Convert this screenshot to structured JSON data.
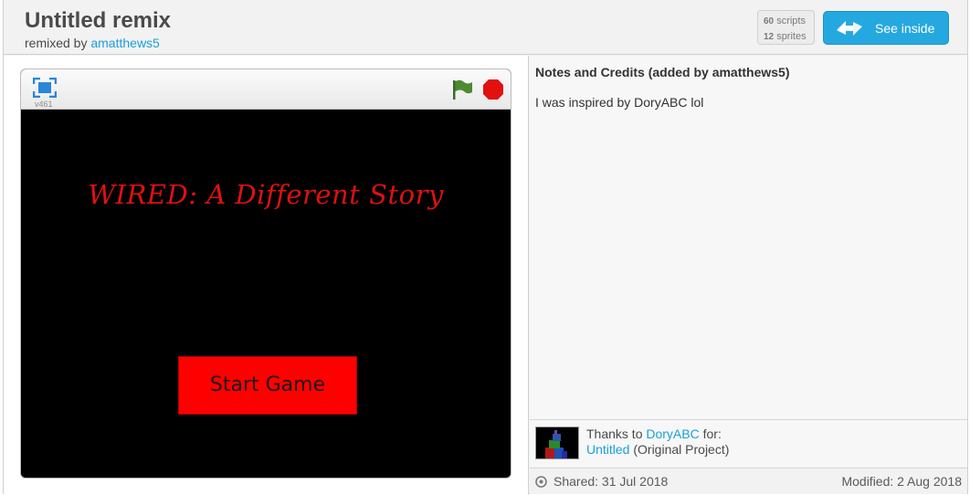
{
  "header": {
    "title": "Untitled remix",
    "remixed_prefix": "remixed by",
    "remixer": "amatthews5",
    "scripts_count": "60",
    "scripts_label": "scripts",
    "sprites_count": "12",
    "sprites_label": "sprites",
    "see_inside_label": "See inside"
  },
  "player": {
    "version": "v461",
    "stage_title": "WIRED: A Different Story",
    "start_button_label": "Start Game"
  },
  "notes": {
    "heading": "Notes and Credits (added by amatthews5)",
    "text": "I was inspired by DoryABC lol"
  },
  "credits": {
    "thanks_prefix": "Thanks to",
    "original_author": "DoryABC",
    "thanks_suffix": "for:",
    "original_project": "Untitled",
    "original_note": "(Original Project)"
  },
  "footer": {
    "shared": "Shared: 31 Jul 2018",
    "modified": "Modified: 2 Aug 2018"
  },
  "colors": {
    "accent": "#25a8e0",
    "link": "#1aa0d8",
    "stage_title": "#e01010",
    "start_button": "#ff0000"
  }
}
